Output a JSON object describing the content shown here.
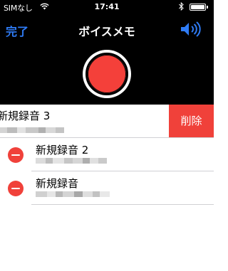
{
  "status_bar": {
    "carrier": "SIMなし",
    "time": "17:41",
    "battery_level": 1.0,
    "icons": [
      "wifi-icon",
      "bluetooth-icon",
      "battery-icon"
    ]
  },
  "nav": {
    "done_label": "完了",
    "title": "ボイスメモ",
    "speaker_icon": "speaker-icon"
  },
  "record_button": {
    "icon": "record-icon",
    "color": "#f4403a"
  },
  "recordings": [
    {
      "title": "新規録音 3"
    },
    {
      "title": "新規録音 2"
    },
    {
      "title": "新規録音"
    }
  ],
  "swipe_action": {
    "label": "削除",
    "color": "#f0413a"
  },
  "colors": {
    "accent": "#2f7cf6",
    "destructive": "#f0413a",
    "top_background": "#000000"
  }
}
